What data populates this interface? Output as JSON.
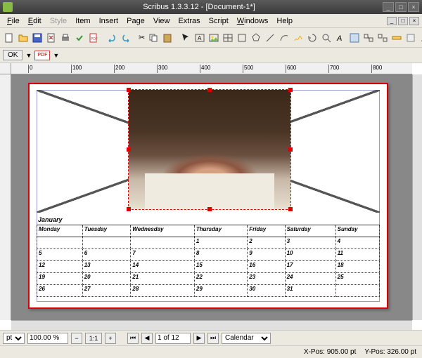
{
  "window": {
    "title": "Scribus 1.3.3.12 - [Document-1*]"
  },
  "menu": {
    "file": "File",
    "edit": "Edit",
    "style": "Style",
    "item": "Item",
    "insert": "Insert",
    "page": "Page",
    "view": "View",
    "extras": "Extras",
    "script": "Script",
    "windows": "Windows",
    "help": "Help"
  },
  "toolbar2": {
    "ok": "OK",
    "pdf": "PDF"
  },
  "ruler_marks": [
    "0",
    "100",
    "200",
    "300",
    "400",
    "500",
    "600",
    "700",
    "800"
  ],
  "calendar": {
    "month": "January",
    "days": [
      "Monday",
      "Tuesday",
      "Wednesday",
      "Thursday",
      "Friday",
      "Saturday",
      "Sunday"
    ],
    "rows": [
      [
        "",
        "",
        "",
        "1",
        "2",
        "3",
        "4"
      ],
      [
        "5",
        "6",
        "7",
        "8",
        "9",
        "10",
        "11"
      ],
      [
        "12",
        "13",
        "14",
        "15",
        "16",
        "17",
        "18"
      ],
      [
        "19",
        "20",
        "21",
        "22",
        "23",
        "24",
        "25"
      ],
      [
        "26",
        "27",
        "28",
        "29",
        "30",
        "31",
        ""
      ]
    ]
  },
  "status": {
    "unit": "pt",
    "zoom": "100.00 %",
    "ratio": "1:1",
    "page": "1 of 12",
    "layer": "Calendar",
    "xpos_label": "X-Pos:",
    "xpos": "905.00 pt",
    "ypos_label": "Y-Pos:",
    "ypos": "326.00 pt"
  }
}
